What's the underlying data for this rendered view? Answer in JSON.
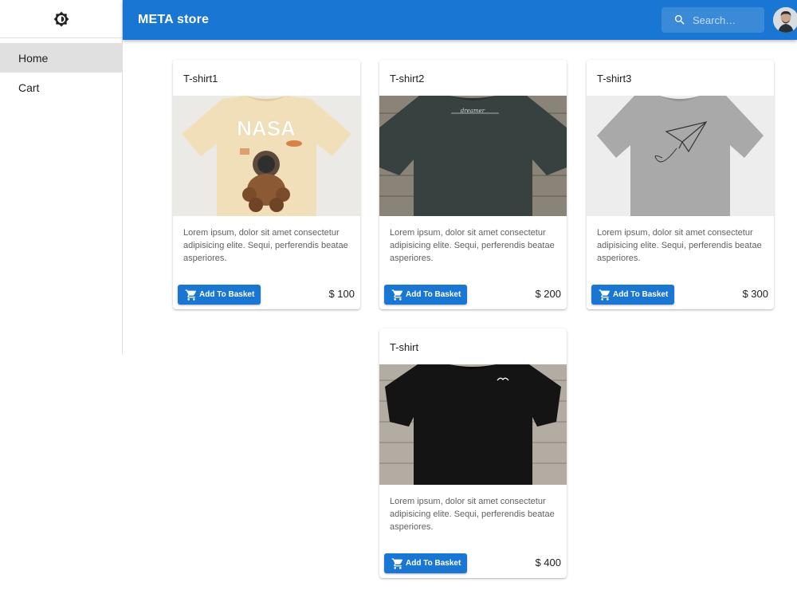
{
  "app": {
    "title": "META store"
  },
  "sidebar": {
    "theme_toggle_icon": "brightness-icon",
    "items": [
      {
        "label": "Home",
        "active": true
      },
      {
        "label": "Cart",
        "active": false
      }
    ]
  },
  "search": {
    "placeholder": "Search…",
    "value": ""
  },
  "colors": {
    "primary": "#1976d2",
    "sidebar_active": "#e0e0e0"
  },
  "products": [
    {
      "title": "T-shirt1",
      "image_icon": "beige-nasa-tshirt-image",
      "description": "Lorem ipsum, dolor sit amet consectetur adipisicing elite. Sequi, perferendis beatae asperiores.",
      "button_label": "Add To Basket",
      "price": "$ 100"
    },
    {
      "title": "T-shirt2",
      "image_icon": "dark-green-tshirt-image",
      "description": "Lorem ipsum, dolor sit amet consectetur adipisicing elite. Sequi, perferendis beatae asperiores.",
      "button_label": "Add To Basket",
      "price": "$ 200"
    },
    {
      "title": "T-shirt3",
      "image_icon": "grey-paper-plane-tshirt-image",
      "description": "Lorem ipsum, dolor sit amet consectetur adipisicing elite. Sequi, perferendis beatae asperiores.",
      "button_label": "Add To Basket",
      "price": "$ 300"
    },
    {
      "title": "T-shirt",
      "image_icon": "black-tshirt-image",
      "description": "Lorem ipsum, dolor sit amet consectetur adipisicing elite. Sequi, perferendis beatae asperiores.",
      "button_label": "Add To Basket",
      "price": "$ 400"
    }
  ]
}
